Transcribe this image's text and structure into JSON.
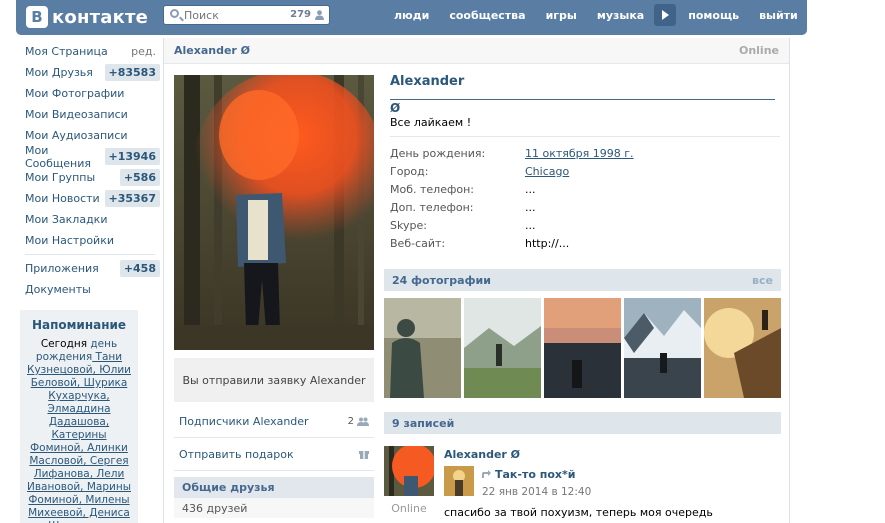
{
  "topbar": {
    "logo_text": "контакте",
    "logo_letter": "B",
    "search_placeholder": "Поиск",
    "search_count": "279",
    "nav": [
      "люди",
      "сообщества",
      "игры",
      "музыка",
      "помощь",
      "выйти"
    ]
  },
  "leftmenu": {
    "items": [
      {
        "label": "Моя Страница",
        "extra": "ред."
      },
      {
        "label": "Мои Друзья",
        "badge": "+83583"
      },
      {
        "label": "Мои Фотографии"
      },
      {
        "label": "Мои Видеозаписи"
      },
      {
        "label": "Мои Аудиозаписи"
      },
      {
        "label": "Мои Сообщения",
        "badge": "+13946"
      },
      {
        "label": "Мои Группы",
        "badge": "+586"
      },
      {
        "label": "Мои Новости",
        "badge": "+35367"
      },
      {
        "label": "Мои Закладки"
      },
      {
        "label": "Мои Настройки"
      }
    ],
    "items2": [
      {
        "label": "Приложения",
        "badge": "+458"
      },
      {
        "label": "Документы"
      }
    ]
  },
  "reminder": {
    "title": "Напоминание",
    "pre": "Сегодня ",
    "emph": "день рождения",
    "names": " Тани Кузнецовой, Юлии Беловой, Шурика Кухарчука, Элмаддина Дадашова, Катерины Фоминой, Алинки Масловой, Сергея Лифанова, Лели Ивановой, Марины Фоминой, Милены Михеевой, Дениса Шмаленко."
  },
  "profile": {
    "header_name": "Alexander Ø",
    "online": "Online",
    "full_name": "Alexander",
    "name_mark": "Ø",
    "status": "Все лайкаем !",
    "fields": [
      {
        "k": "День рождения:",
        "v": "11 октября 1998 г.",
        "link": true
      },
      {
        "k": "Город:",
        "v": "Chicago",
        "link": true
      },
      {
        "k": "Моб. телефон:",
        "v": "...",
        "link": false
      },
      {
        "k": "Доп. телефон:",
        "v": "...",
        "link": false
      },
      {
        "k": "Skype:",
        "v": "...",
        "link": false
      },
      {
        "k": "Веб-сайт:",
        "v": "http://...",
        "link": false
      }
    ],
    "request_sent": "Вы отправили заявку Alexander",
    "subscribers_label": "Подписчики Alexander",
    "subscribers_count": "2",
    "gift_label": "Отправить подарок",
    "common_friends_title": "Общие друзья",
    "common_friends_count": "436 друзей"
  },
  "photos": {
    "title": "24 фотографии",
    "all": "все"
  },
  "wall": {
    "title": "9 записей",
    "post": {
      "author": "Alexander Ø",
      "online": "Online",
      "repost_title": "Так-то пох*й",
      "date": "22 янв 2014 в 12:40",
      "text": "спасибо за твой похуизм, теперь моя очередь"
    }
  }
}
